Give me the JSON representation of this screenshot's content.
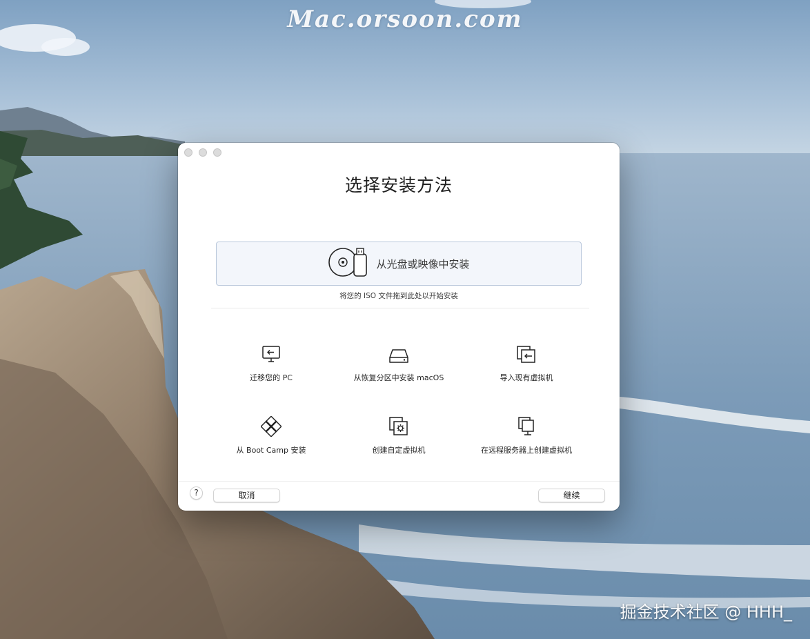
{
  "watermarks": {
    "top": "Mac.orsoon.com",
    "bottom": "掘金技术社区 @ HHH_"
  },
  "window": {
    "title": "选择安装方法",
    "dropzone": {
      "label": "从光盘或映像中安装",
      "hint": "将您的 ISO 文件拖到此处以开始安装",
      "icon": "disc-usb-icon"
    },
    "options": [
      {
        "label": "迁移您的 PC",
        "icon": "migrate-pc-icon"
      },
      {
        "label": "从恢复分区中安装 macOS",
        "icon": "drive-icon"
      },
      {
        "label": "导入现有虚拟机",
        "icon": "import-vm-icon"
      },
      {
        "label": "从 Boot Camp 安装",
        "icon": "bootcamp-icon"
      },
      {
        "label": "创建自定虚拟机",
        "icon": "custom-vm-icon"
      },
      {
        "label": "在远程服务器上创建虚拟机",
        "icon": "remote-vm-icon"
      }
    ],
    "footer": {
      "help": "?",
      "cancel": "取消",
      "continue": "继续"
    }
  }
}
